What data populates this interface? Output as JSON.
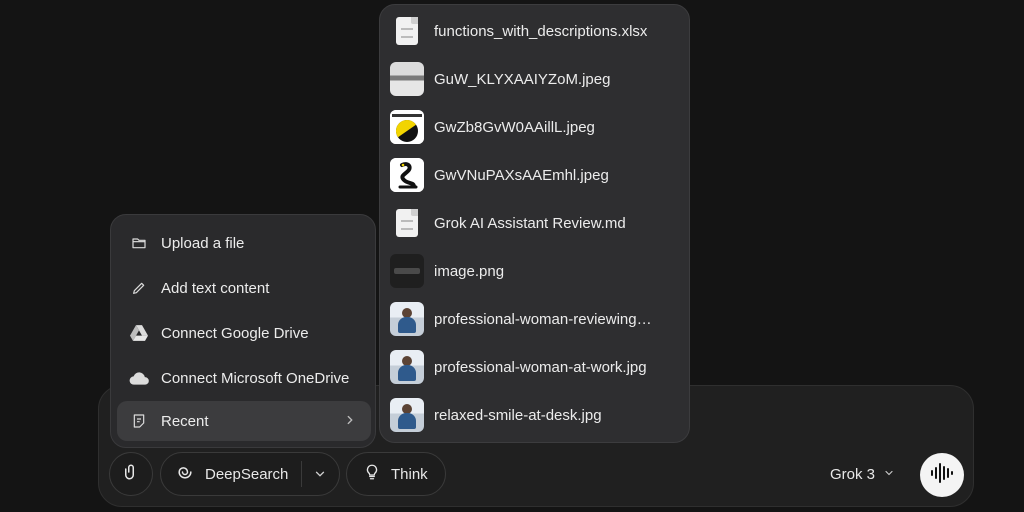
{
  "composer": {
    "deepsearch_label": "DeepSearch",
    "think_label": "Think",
    "model_label": "Grok 3"
  },
  "attach_menu": {
    "items": [
      {
        "label": "Upload a file",
        "icon": "folder-icon"
      },
      {
        "label": "Add text content",
        "icon": "pencil-icon"
      },
      {
        "label": "Connect Google Drive",
        "icon": "google-drive-icon"
      },
      {
        "label": "Connect Microsoft OneDrive",
        "icon": "onedrive-icon"
      },
      {
        "label": "Recent",
        "icon": "recent-icon",
        "active": true
      }
    ]
  },
  "recent_files": [
    {
      "name": "functions_with_descriptions.xlsx",
      "thumb": "document"
    },
    {
      "name": "GuW_KLYXAAIYZoM.jpeg",
      "thumb": "image"
    },
    {
      "name": "GwZb8GvW0AAillL.jpeg",
      "thumb": "image"
    },
    {
      "name": "GwVNuPAXsAAEmhl.jpeg",
      "thumb": "image"
    },
    {
      "name": "Grok AI Assistant Review.md",
      "thumb": "document"
    },
    {
      "name": "image.png",
      "thumb": "image"
    },
    {
      "name": "professional-woman-reviewing…",
      "thumb": "image"
    },
    {
      "name": "professional-woman-at-work.jpg",
      "thumb": "image"
    },
    {
      "name": "relaxed-smile-at-desk.jpg",
      "thumb": "image"
    }
  ]
}
